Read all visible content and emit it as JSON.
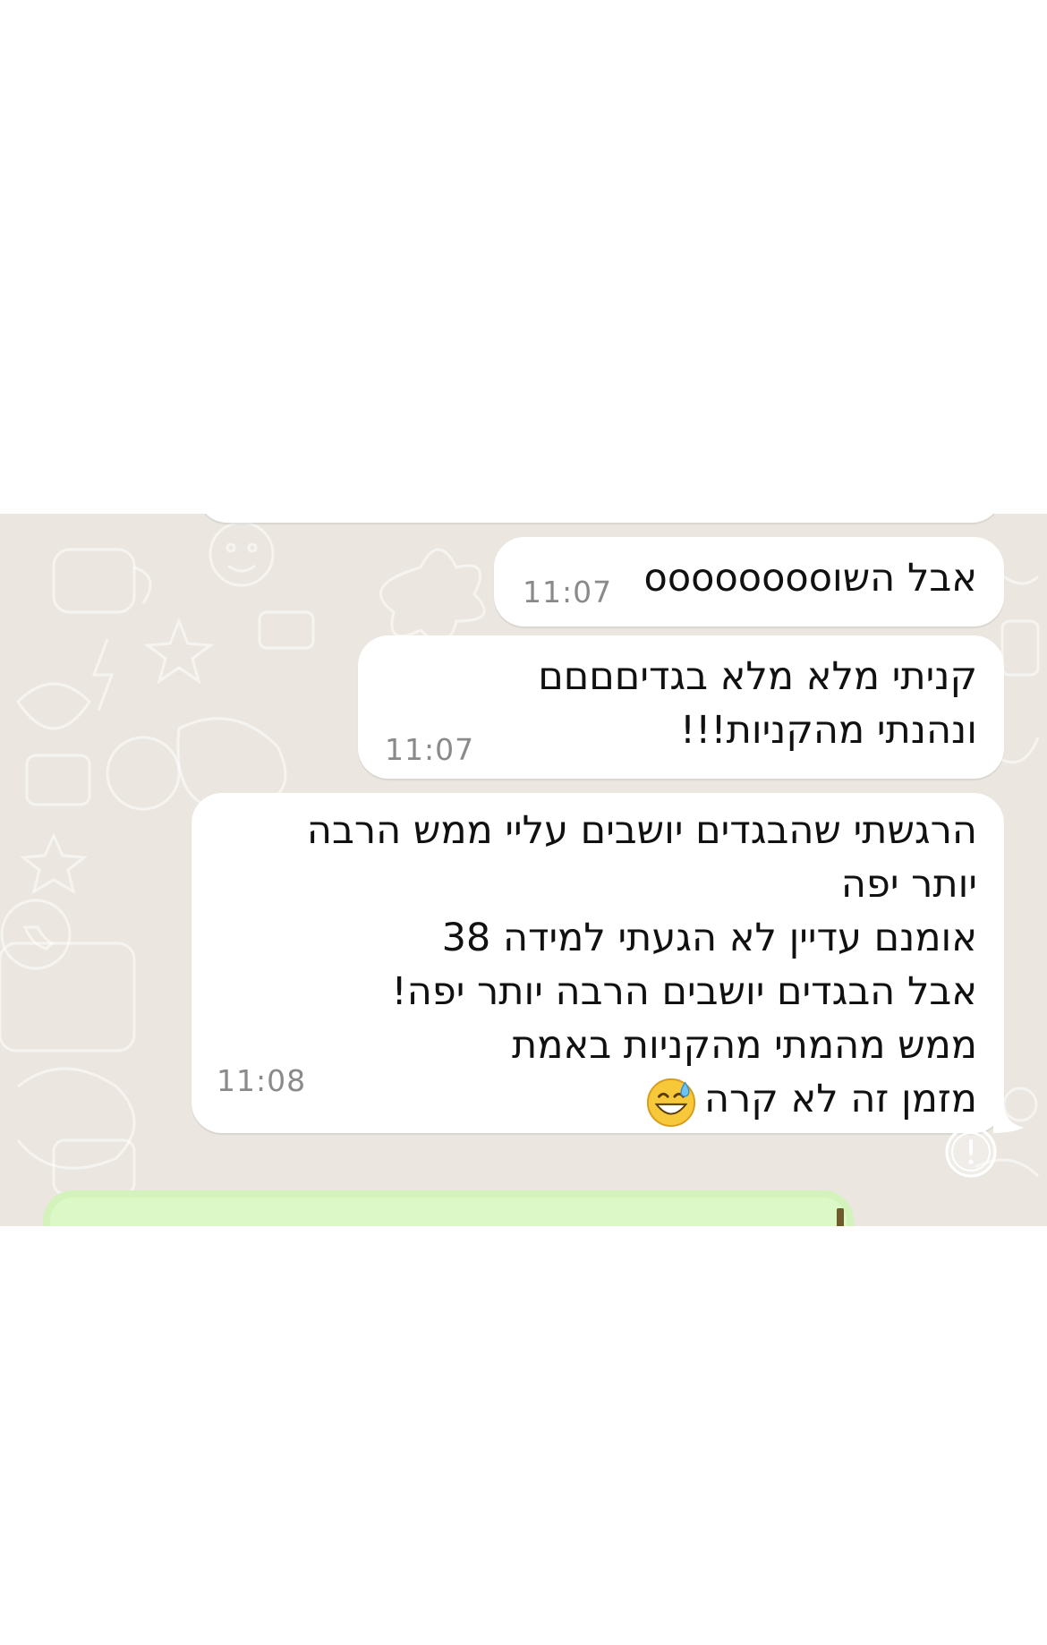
{
  "chat": {
    "messages": [
      {
        "lines": [
          "אבל השוoooooooo"
        ],
        "time": "11:07"
      },
      {
        "lines": [
          "קניתי מלא מלא בגדיםםםם",
          "ונהנתי מהקניות!!!"
        ],
        "time": "11:07"
      },
      {
        "lines": [
          "הרגשתי שהבגדים יושבים עליי ממש הרבה",
          "יותר יפה",
          "אומנם עדיין לא הגעתי למידה 38",
          "אבל הבגדים יושבים הרבה יותר יפה!",
          "ממש מהמתי מהקניות באמת",
          "מזמן זה לא קרה"
        ],
        "time": "11:08",
        "emoji": "grinning-face-with-sweat-icon"
      }
    ]
  },
  "colors": {
    "wallpaper": "#ebe7e0",
    "incoming_bubble": "#ffffff",
    "outgoing_bubble": "#dcf8c6",
    "timestamp": "#8a8a8a"
  }
}
